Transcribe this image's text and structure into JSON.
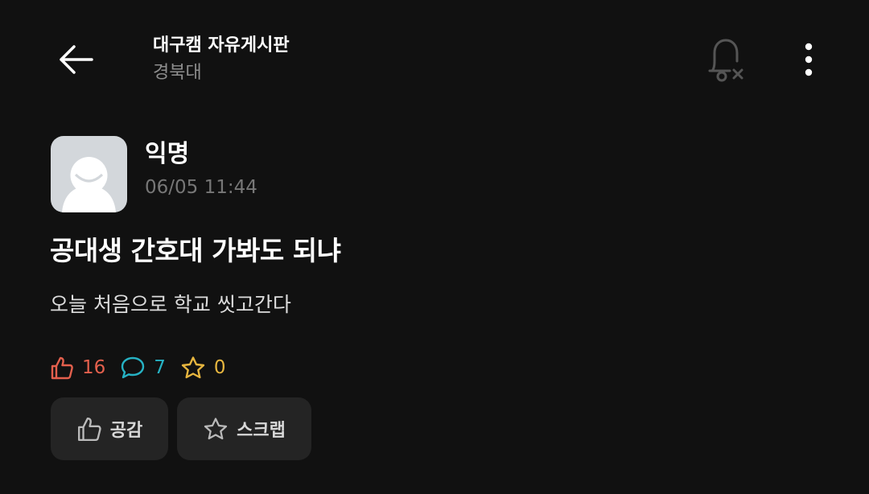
{
  "header": {
    "board_title": "대구캠 자유게시판",
    "school": "경북대",
    "icons": {
      "back": "arrow-left-icon",
      "notification": "bell-off-icon",
      "more": "more-vertical-icon"
    }
  },
  "post": {
    "author": "익명",
    "time": "06/05 11:44",
    "title": "공대생 간호대 가봐도 되냐",
    "body": "오늘 처음으로 학교 씻고간다",
    "stats": {
      "likes": "16",
      "comments": "7",
      "scraps": "0"
    }
  },
  "actions": {
    "like_label": "공감",
    "scrap_label": "스크랩"
  },
  "colors": {
    "background": "#111111",
    "like": "#e4604d",
    "comment": "#26b2c4",
    "scrap": "#e7b63f",
    "button_bg": "#242424"
  }
}
